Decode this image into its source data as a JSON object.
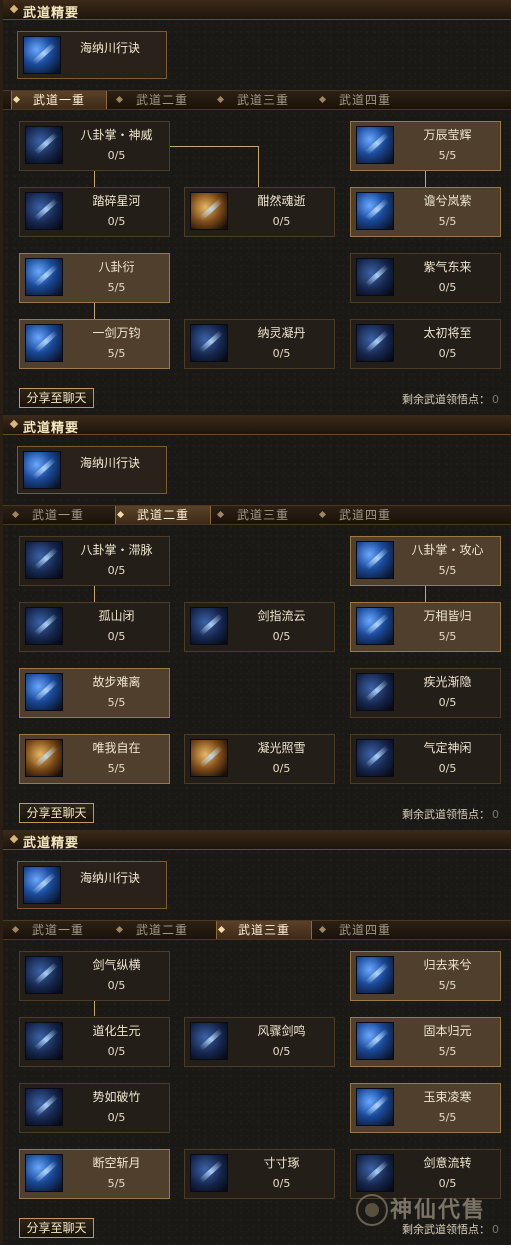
{
  "panels": [
    {
      "section_title": "武道精要",
      "essence": {
        "name": "海纳川行诀"
      },
      "tabs": [
        "武道一重",
        "武道二重",
        "武道三重",
        "武道四重"
      ],
      "active_tab": 0,
      "skills": [
        {
          "name": "八卦掌・神威",
          "points": "0/5",
          "lit": false,
          "icon": "palm-strike-icon"
        },
        {
          "name": "万辰莹辉",
          "points": "5/5",
          "lit": true,
          "icon": "star-orb-icon"
        },
        {
          "name": "踏碎星河",
          "points": "0/5",
          "lit": false,
          "icon": "sword-slash-icon"
        },
        {
          "name": "酣然魂逝",
          "points": "0/5",
          "lit": false,
          "icon": "spirit-fade-icon"
        },
        {
          "name": "谵兮岚萦",
          "points": "5/5",
          "lit": true,
          "icon": "mist-swirl-icon"
        },
        {
          "name": "八卦衍",
          "points": "5/5",
          "lit": true,
          "icon": "bagua-icon"
        },
        {
          "name": "紫气东来",
          "points": "0/5",
          "lit": false,
          "icon": "purple-qi-icon"
        },
        {
          "name": "一剑万钧",
          "points": "5/5",
          "lit": true,
          "icon": "heavy-sword-icon"
        },
        {
          "name": "纳灵凝丹",
          "points": "0/5",
          "lit": false,
          "icon": "elixir-icon"
        },
        {
          "name": "太初将至",
          "points": "0/5",
          "lit": false,
          "icon": "primordial-icon"
        }
      ],
      "share_label": "分享至聊天",
      "remaining_label": "剩余武道领悟点：",
      "remaining_value": "0"
    },
    {
      "section_title": "武道精要",
      "essence": {
        "name": "海纳川行诀"
      },
      "tabs": [
        "武道一重",
        "武道二重",
        "武道三重",
        "武道四重"
      ],
      "active_tab": 1,
      "skills": [
        {
          "name": "八卦掌・滞脉",
          "points": "0/5",
          "lit": false,
          "icon": "palm-strike-icon"
        },
        {
          "name": "八卦掌・攻心",
          "points": "5/5",
          "lit": true,
          "icon": "palm-heart-icon"
        },
        {
          "name": "孤山闭",
          "points": "0/5",
          "lit": false,
          "icon": "mountain-icon"
        },
        {
          "name": "剑指流云",
          "points": "0/5",
          "lit": false,
          "icon": "cloud-sword-icon"
        },
        {
          "name": "万相皆归",
          "points": "5/5",
          "lit": true,
          "icon": "return-swirl-icon"
        },
        {
          "name": "故步难离",
          "points": "5/5",
          "lit": true,
          "icon": "footstep-icon"
        },
        {
          "name": "疾光渐隐",
          "points": "0/5",
          "lit": false,
          "icon": "fading-light-icon"
        },
        {
          "name": "唯我自在",
          "points": "5/5",
          "lit": true,
          "icon": "warrior-icon"
        },
        {
          "name": "凝光照雪",
          "points": "0/5",
          "lit": false,
          "icon": "snow-light-icon"
        },
        {
          "name": "气定神闲",
          "points": "0/5",
          "lit": false,
          "icon": "calm-spirit-icon"
        }
      ],
      "share_label": "分享至聊天",
      "remaining_label": "剩余武道领悟点：",
      "remaining_value": "0"
    },
    {
      "section_title": "武道精要",
      "essence": {
        "name": "海纳川行诀"
      },
      "tabs": [
        "武道一重",
        "武道二重",
        "武道三重",
        "武道四重"
      ],
      "active_tab": 2,
      "skills": [
        {
          "name": "剑气纵横",
          "points": "0/5",
          "lit": false,
          "icon": "sword-qi-icon"
        },
        {
          "name": "归去来兮",
          "points": "5/5",
          "lit": true,
          "icon": "return-icon"
        },
        {
          "name": "道化生元",
          "points": "0/5",
          "lit": false,
          "icon": "dao-origin-icon"
        },
        {
          "name": "风骤剑鸣",
          "points": "0/5",
          "lit": false,
          "icon": "wind-sword-icon"
        },
        {
          "name": "固本归元",
          "points": "5/5",
          "lit": true,
          "icon": "foundation-icon"
        },
        {
          "name": "势如破竹",
          "points": "0/5",
          "lit": false,
          "icon": "bamboo-icon"
        },
        {
          "name": "玉束凌寒",
          "points": "5/5",
          "lit": true,
          "icon": "jade-frost-icon"
        },
        {
          "name": "断空斩月",
          "points": "5/5",
          "lit": true,
          "icon": "moon-slash-icon"
        },
        {
          "name": "寸寸琢",
          "points": "0/5",
          "lit": false,
          "icon": "carve-icon"
        },
        {
          "name": "剑意流转",
          "points": "0/5",
          "lit": false,
          "icon": "sword-flow-icon"
        }
      ],
      "share_label": "分享至聊天",
      "remaining_label": "剩余武道领悟点：",
      "remaining_value": "0"
    }
  ],
  "watermark": "神仙代售"
}
